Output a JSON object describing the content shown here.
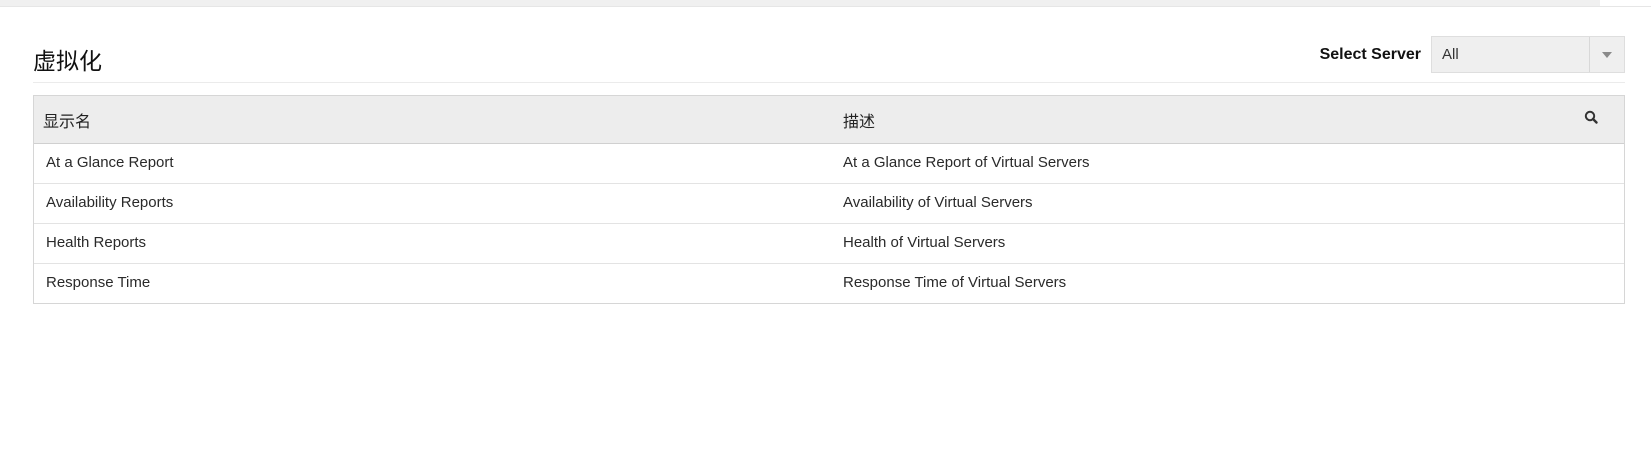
{
  "page": {
    "title": "虚拟化"
  },
  "server_select": {
    "label": "Select Server",
    "value": "All",
    "icon": "chevron-down-icon"
  },
  "table": {
    "columns": [
      "显示名",
      "描述"
    ],
    "search_icon": "search-icon",
    "rows": [
      {
        "name": "At a Glance Report",
        "description": "At a Glance Report of Virtual Servers"
      },
      {
        "name": "Availability Reports",
        "description": "Availability of Virtual Servers"
      },
      {
        "name": "Health Reports",
        "description": "Health of Virtual Servers"
      },
      {
        "name": "Response Time",
        "description": "Response Time of Virtual Servers"
      }
    ]
  }
}
